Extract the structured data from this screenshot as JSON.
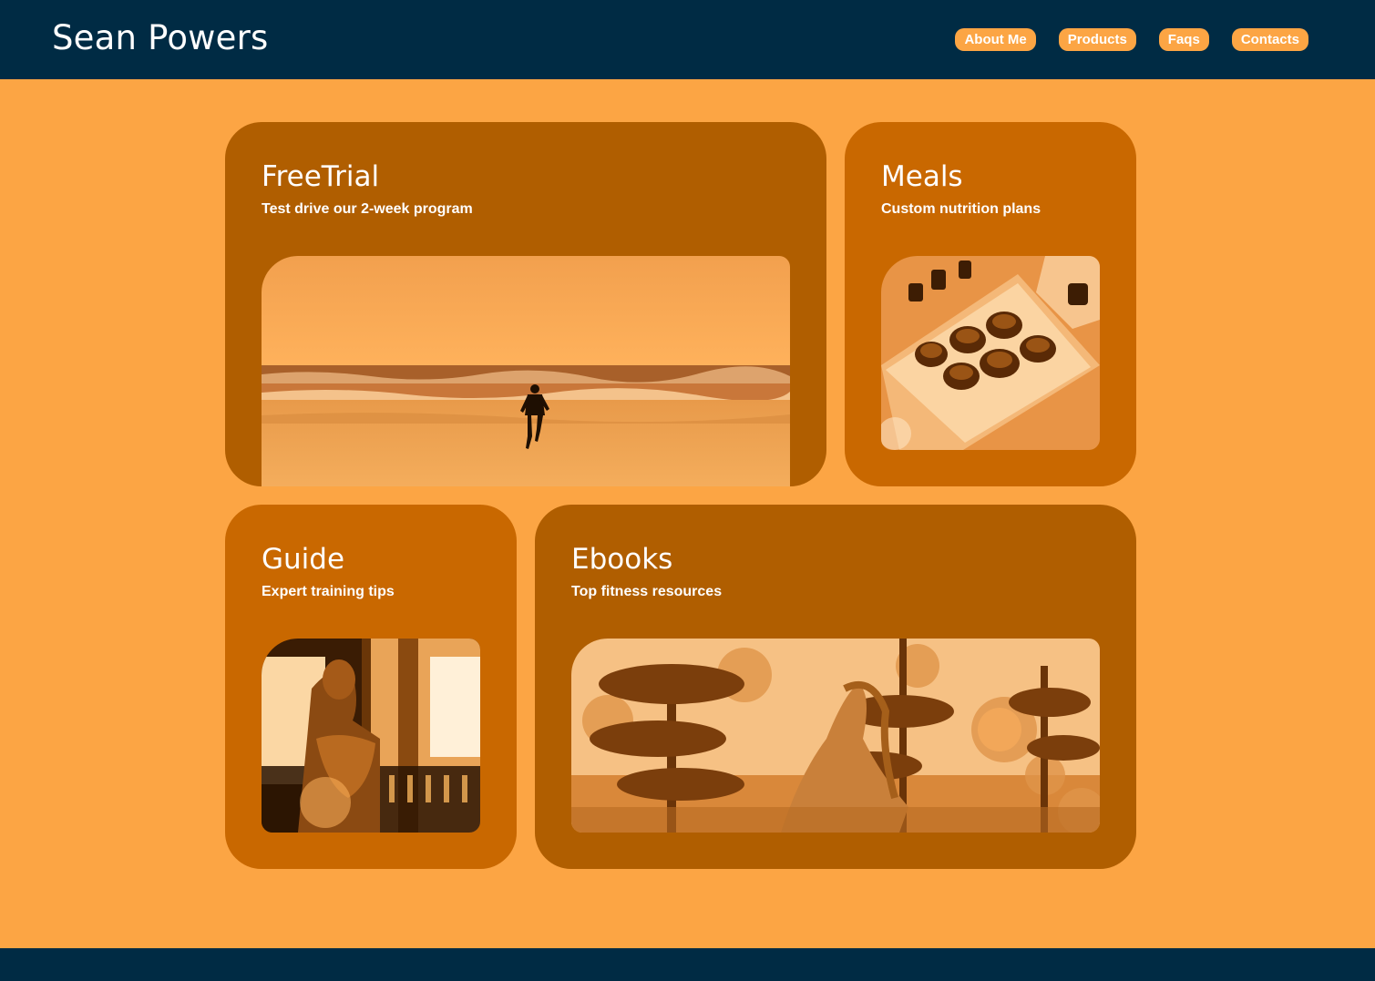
{
  "header": {
    "site_title": "Sean Powers",
    "nav": [
      "About Me",
      "Products",
      "Faqs",
      "Contacts"
    ]
  },
  "cards": [
    {
      "title": "FreeTrial",
      "subtitle": "Test drive our 2-week program",
      "image_icon": "beach-runner-image"
    },
    {
      "title": "Meals",
      "subtitle": "Custom nutrition plans",
      "image_icon": "meal-plate-image"
    },
    {
      "title": "Guide",
      "subtitle": "Expert training tips",
      "image_icon": "gym-athlete-image"
    },
    {
      "title": "Ebooks",
      "subtitle": "Top fitness resources",
      "image_icon": "sculpture-garden-image"
    }
  ],
  "colors": {
    "header_bg": "#002b44",
    "page_bg": "#fca544",
    "card_dark": "#b05e00",
    "card_light": "#c96800",
    "text": "#ffffff"
  }
}
